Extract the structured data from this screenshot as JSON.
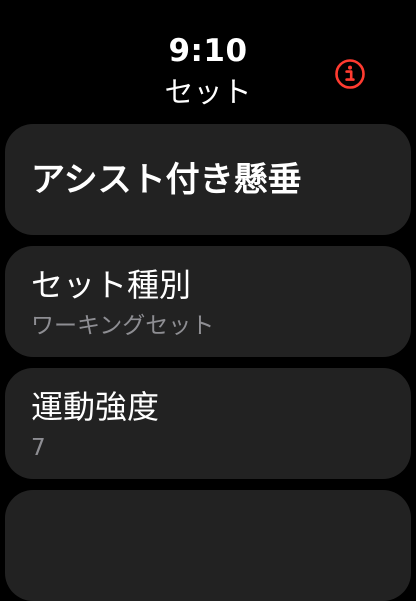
{
  "status": {
    "time": "9:10",
    "title": "セット"
  },
  "icons": {
    "info": "info-icon",
    "accent": "#ff3b30"
  },
  "exercise": {
    "name": "アシスト付き懸垂"
  },
  "set_type": {
    "label": "セット種別",
    "value": "ワーキングセット"
  },
  "intensity": {
    "label": "運動強度",
    "value": "7"
  },
  "colors": {
    "background": "#000000",
    "card": "#222222",
    "secondary_text": "#8e8e93"
  }
}
